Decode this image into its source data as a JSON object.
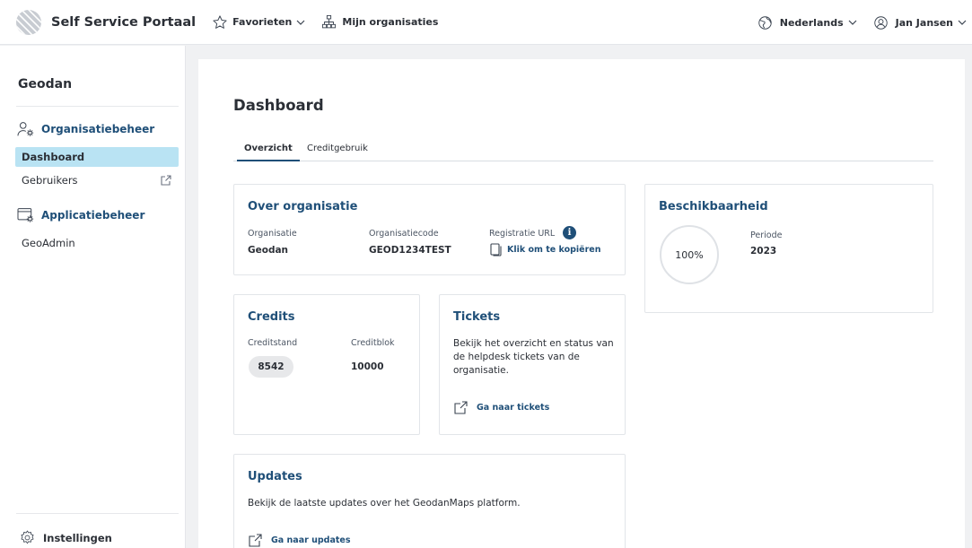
{
  "header": {
    "app_title": "Self Service Portaal",
    "favorites_label": "Favorieten",
    "organisations_label": "Mijn organisaties",
    "language_label": "Nederlands",
    "user_label": "Jan Jansen"
  },
  "sidebar": {
    "org_name": "Geodan",
    "section_org": "Organisatiebeheer",
    "item_dashboard": "Dashboard",
    "item_users": "Gebruikers",
    "section_apps": "Applicatiebeheer",
    "item_geoadmin": "GeoAdmin",
    "settings_label": "Instellingen"
  },
  "main": {
    "title": "Dashboard",
    "tabs": [
      {
        "label": "Overzicht"
      },
      {
        "label": "Creditgebruik"
      }
    ],
    "org_card": {
      "title": "Over organisatie",
      "org_label": "Organisatie",
      "org_value": "Geodan",
      "code_label": "Organisatiecode",
      "code_value": "GEOD1234TEST",
      "url_label": "Registratie URL",
      "info_glyph": "i",
      "copy_link": "Klik om te kopiëren"
    },
    "availability_card": {
      "title": "Beschikbaarheid",
      "percentage": "100%",
      "period_label": "Periode",
      "period_value": "2023"
    },
    "credits_card": {
      "title": "Credits",
      "balance_label": "Creditstand",
      "balance_value": "8542",
      "block_label": "Creditblok",
      "block_value": "10000"
    },
    "tickets_card": {
      "title": "Tickets",
      "description": "Bekijk het overzicht en status van de helpdesk tickets van de organisatie.",
      "link": "Ga naar tickets"
    },
    "updates_card": {
      "title": "Updates",
      "description": "Bekijk de laatste updates over het GeodanMaps platform.",
      "link": "Ga naar updates"
    }
  },
  "icons": {
    "logo": "geodan-logo-icon",
    "favorites": "star-icon",
    "organisations": "org-tree-icon",
    "language": "globe-icon",
    "user": "user-circle-icon",
    "org_admin": "users-gear-icon",
    "app_admin": "window-gear-icon",
    "external": "external-link-icon",
    "copy": "copy-icon",
    "settings": "gear-icon"
  },
  "colors": {
    "accent": "#1f4f78",
    "active_nav": "#b9e3f3",
    "background": "#f0f1f3"
  }
}
